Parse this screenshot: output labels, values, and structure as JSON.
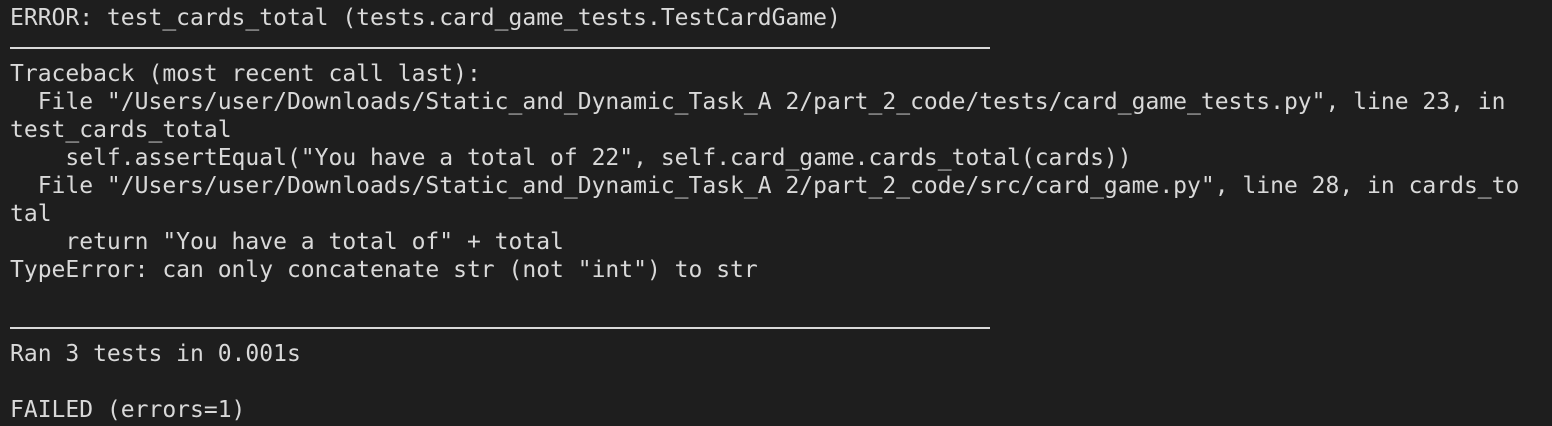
{
  "terminal": {
    "error_header": "ERROR: test_cards_total (tests.card_game_tests.TestCardGame)",
    "traceback_header": "Traceback (most recent call last):",
    "frame1_file": "  File \"/Users/user/Downloads/Static_and_Dynamic_Task_A 2/part_2_code/tests/card_game_tests.py\", line 23, in",
    "frame1_func_wrap": "test_cards_total",
    "frame1_code": "    self.assertEqual(\"You have a total of 22\", self.card_game.cards_total(cards))",
    "frame2_file": "  File \"/Users/user/Downloads/Static_and_Dynamic_Task_A 2/part_2_code/src/card_game.py\", line 28, in cards_to",
    "frame2_func_wrap": "tal",
    "frame2_code": "    return \"You have a total of\" + total",
    "exception": "TypeError: can only concatenate str (not \"int\") to str",
    "summary": "Ran 3 tests in 0.001s",
    "result": "FAILED (errors=1)"
  },
  "colors": {
    "background": "#1e1e1e",
    "text": "#d9d9d9"
  }
}
